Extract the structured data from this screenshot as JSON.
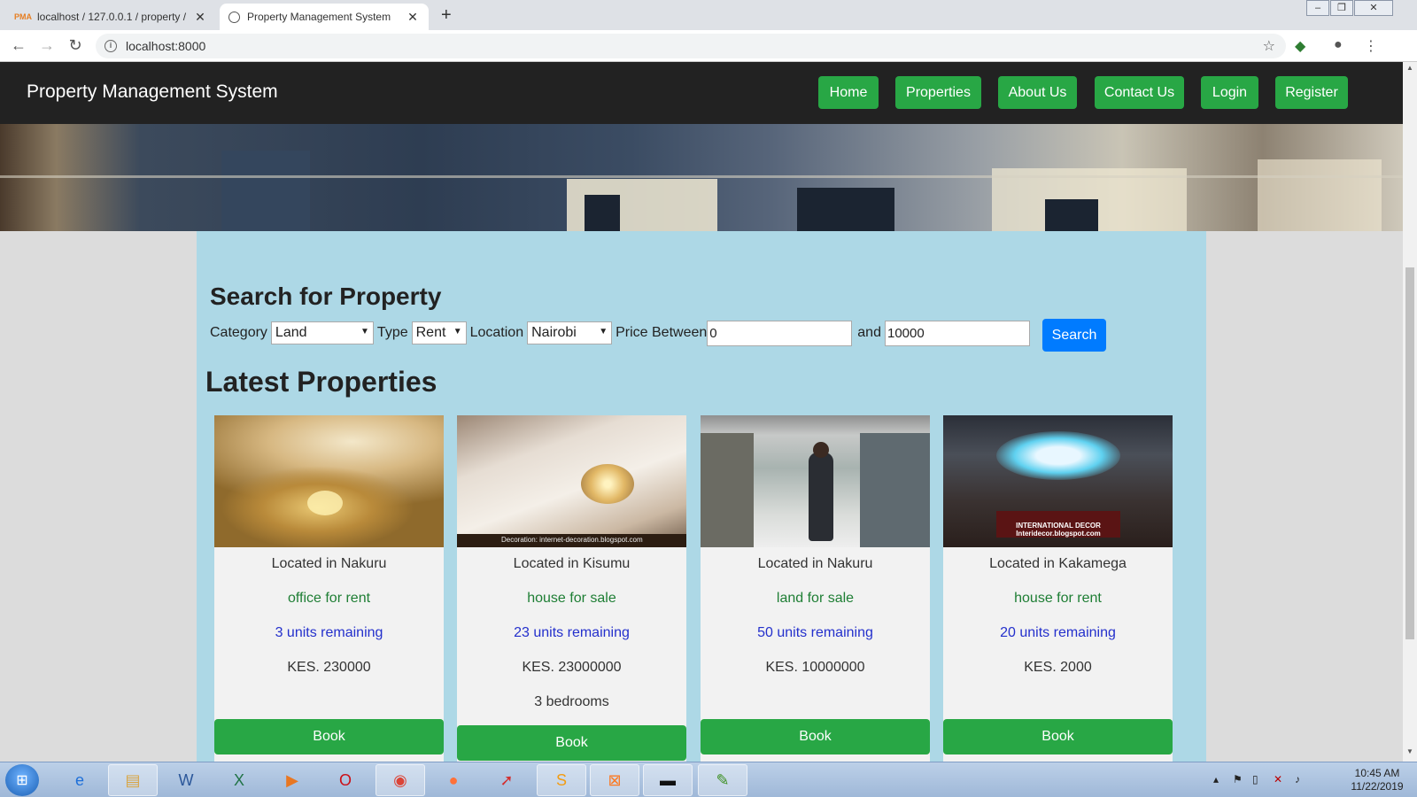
{
  "browser": {
    "tabs": [
      {
        "title": "localhost / 127.0.0.1 / property / ",
        "icon": "phpmyadmin-icon"
      },
      {
        "title": "Property Management System",
        "icon": "globe-icon"
      }
    ],
    "pma_badge": "PMA",
    "address": "localhost:8000"
  },
  "nav": {
    "brand": "Property Management System",
    "links": [
      "Home",
      "Properties",
      "About Us",
      "Contact Us",
      "Login",
      "Register"
    ]
  },
  "search": {
    "heading": "Search for Property",
    "category_label": "Category",
    "category_value": "Land",
    "type_label": "Type",
    "type_value": "Rent",
    "location_label": "Location",
    "location_value": "Nairobi",
    "price_label": "Price Between",
    "min_price": "0",
    "and_label": "and",
    "max_price": "10000",
    "button": "Search"
  },
  "latest": {
    "heading": "Latest Properties",
    "cards": [
      {
        "location": "Located in Nakuru",
        "category": "office for rent",
        "units": "3 units remaining",
        "price": "KES. 230000",
        "bedrooms": "",
        "book": "Book"
      },
      {
        "location": "Located in Kisumu",
        "category": "house for sale",
        "units": "23 units remaining",
        "price": "KES. 23000000",
        "bedrooms": "3 bedrooms",
        "book": "Book",
        "photo_caption": "Decoration: internet-decoration.blogspot.com"
      },
      {
        "location": "Located in Nakuru",
        "category": "land for sale",
        "units": "50 units remaining",
        "price": "KES. 10000000",
        "bedrooms": "",
        "book": "Book"
      },
      {
        "location": "Located in Kakamega",
        "category": "house for rent",
        "units": "20 units remaining",
        "price": "KES. 2000",
        "bedrooms": "",
        "book": "Book",
        "photo_caption": "INTERNATIONAL DECOR Interidecor.blogspot.com"
      }
    ]
  },
  "taskbar": {
    "time": "10:45 AM",
    "date": "11/22/2019"
  }
}
